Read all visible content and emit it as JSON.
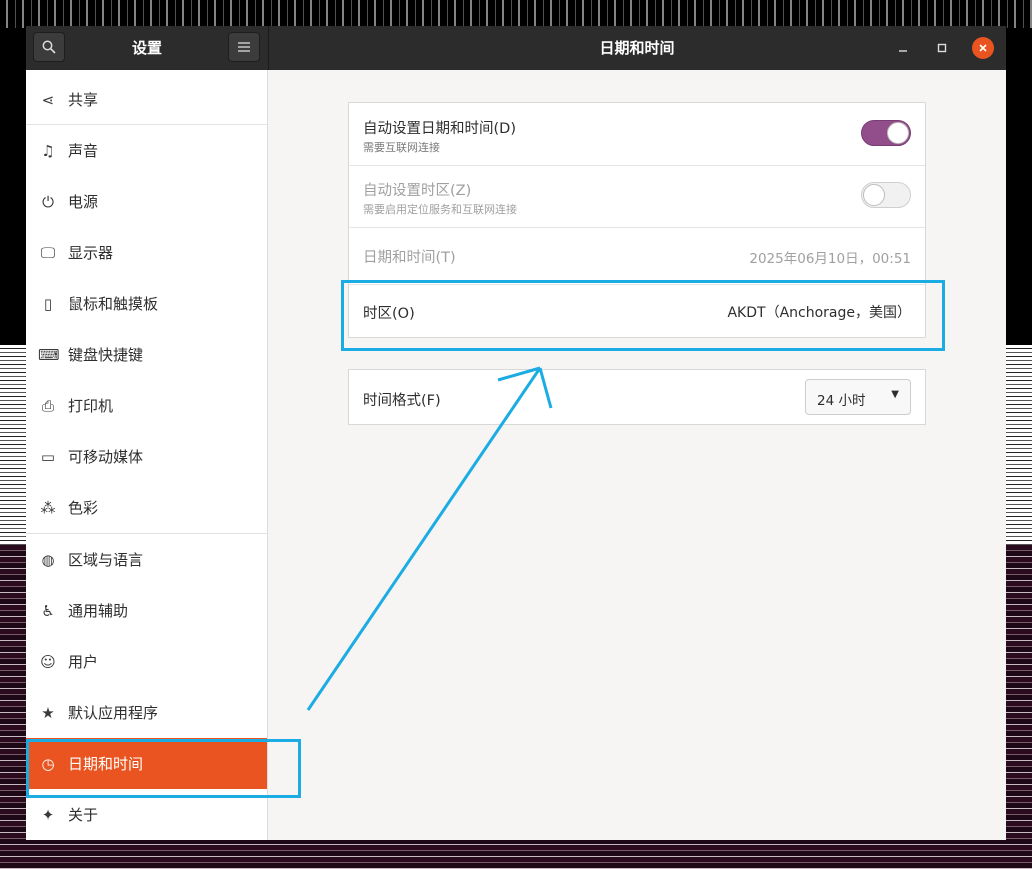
{
  "window": {
    "sidebar_title": "设置",
    "page_title": "日期和时间",
    "controls": {
      "minimize": "–",
      "maximize": "▫",
      "close": "✕"
    }
  },
  "sidebar": {
    "items": [
      {
        "label": "共享",
        "icon": "share-icon"
      },
      {
        "label": "声音",
        "icon": "music-note-icon"
      },
      {
        "label": "电源",
        "icon": "power-icon"
      },
      {
        "label": "显示器",
        "icon": "display-icon"
      },
      {
        "label": "鼠标和触摸板",
        "icon": "mouse-icon"
      },
      {
        "label": "键盘快捷键",
        "icon": "keyboard-icon"
      },
      {
        "label": "打印机",
        "icon": "printer-icon"
      },
      {
        "label": "可移动媒体",
        "icon": "removable-media-icon"
      },
      {
        "label": "色彩",
        "icon": "color-icon"
      },
      {
        "label": "区域与语言",
        "icon": "globe-icon"
      },
      {
        "label": "通用辅助",
        "icon": "accessibility-icon"
      },
      {
        "label": "用户",
        "icon": "users-icon"
      },
      {
        "label": "默认应用程序",
        "icon": "star-icon"
      },
      {
        "label": "日期和时间",
        "icon": "clock-icon",
        "active": true
      },
      {
        "label": "关于",
        "icon": "sparkle-icon"
      }
    ]
  },
  "settings": {
    "auto_datetime": {
      "title": "自动设置日期和时间(D)",
      "subtitle": "需要互联网连接",
      "enabled": true
    },
    "auto_timezone": {
      "title": "自动设置时区(Z)",
      "subtitle": "需要启用定位服务和互联网连接",
      "enabled": false
    },
    "datetime": {
      "title": "日期和时间(T)",
      "value": "2025年06月10日，00:51"
    },
    "timezone": {
      "title": "时区(O)",
      "value": "AKDT（Anchorage，美国）"
    },
    "time_format": {
      "title": "时间格式(F)",
      "value": "24 小时"
    }
  },
  "colors": {
    "accent": "#e95420",
    "toggle_on": "#924d8b",
    "annotation": "#1aace3",
    "headerbar": "#2c2c2c"
  }
}
